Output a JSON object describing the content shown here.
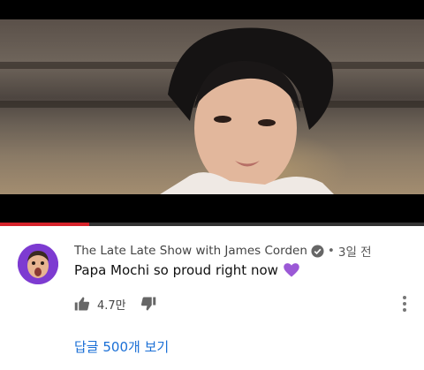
{
  "video": {
    "progress_fraction": 0.21,
    "progress_color": "#d6232a"
  },
  "comment": {
    "author": "The Late Late Show with James Corden",
    "separator": "•",
    "time": "3일 전",
    "text": "Papa Mochi so proud right now",
    "emoji": "purple-heart",
    "likes": "4.7만",
    "replies_label": "답글 500개 보기",
    "colors": {
      "link": "#1a6fd6",
      "avatar_bg": "#7d3bd1",
      "heart": "#9b59d6"
    }
  }
}
